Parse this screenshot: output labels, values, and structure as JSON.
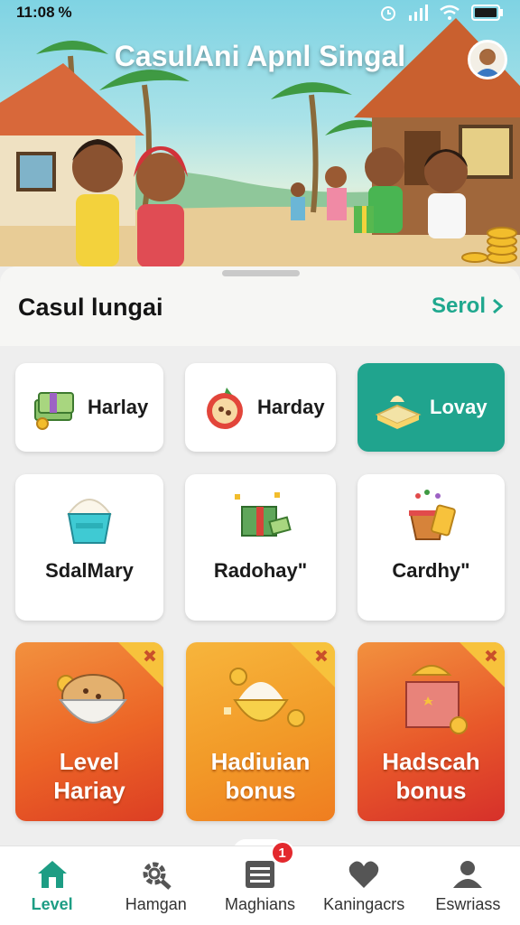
{
  "status": {
    "time": "11:08",
    "icons": [
      "percent-icon",
      "alarm-icon",
      "signal-icon",
      "wifi-icon",
      "battery-icon"
    ]
  },
  "hero": {
    "title": "CasulAni Apnl Singal"
  },
  "section": {
    "title": "Casul lungai",
    "see_all": "Serol"
  },
  "row1": [
    {
      "label": "Harlay",
      "icon": "money-stack-icon"
    },
    {
      "label": "Harday",
      "icon": "pizza-icon"
    },
    {
      "label": "Lovay",
      "icon": "cake-box-icon",
      "active": true
    }
  ],
  "row2": [
    {
      "label": "SdalMary",
      "icon": "ice-cream-cup-icon"
    },
    {
      "label": "Radohay\"",
      "icon": "gift-money-icon"
    },
    {
      "label": "Cardhy\"",
      "icon": "gift-basket-icon"
    }
  ],
  "row3": [
    {
      "label_line1": "Level",
      "label_line2": "Hariay",
      "icon": "cookie-bowl-icon"
    },
    {
      "label_line1": "Hadiuian",
      "label_line2": "bonus",
      "icon": "cream-bowl-icon"
    },
    {
      "label_line1": "Hadscah",
      "label_line2": "bonus",
      "icon": "treasure-box-icon"
    }
  ],
  "nav": [
    {
      "label": "Level",
      "icon": "home-icon",
      "active": true
    },
    {
      "label": "Hamgan",
      "icon": "gear-search-icon"
    },
    {
      "label": "Maghians",
      "icon": "list-icon",
      "badge": "1"
    },
    {
      "label": "Kaningacrs",
      "icon": "heart-icon"
    },
    {
      "label": "Eswriass",
      "icon": "user-icon"
    }
  ],
  "colors": {
    "accent": "#20a48e",
    "orange": "#f0801e",
    "red": "#e3292e"
  }
}
